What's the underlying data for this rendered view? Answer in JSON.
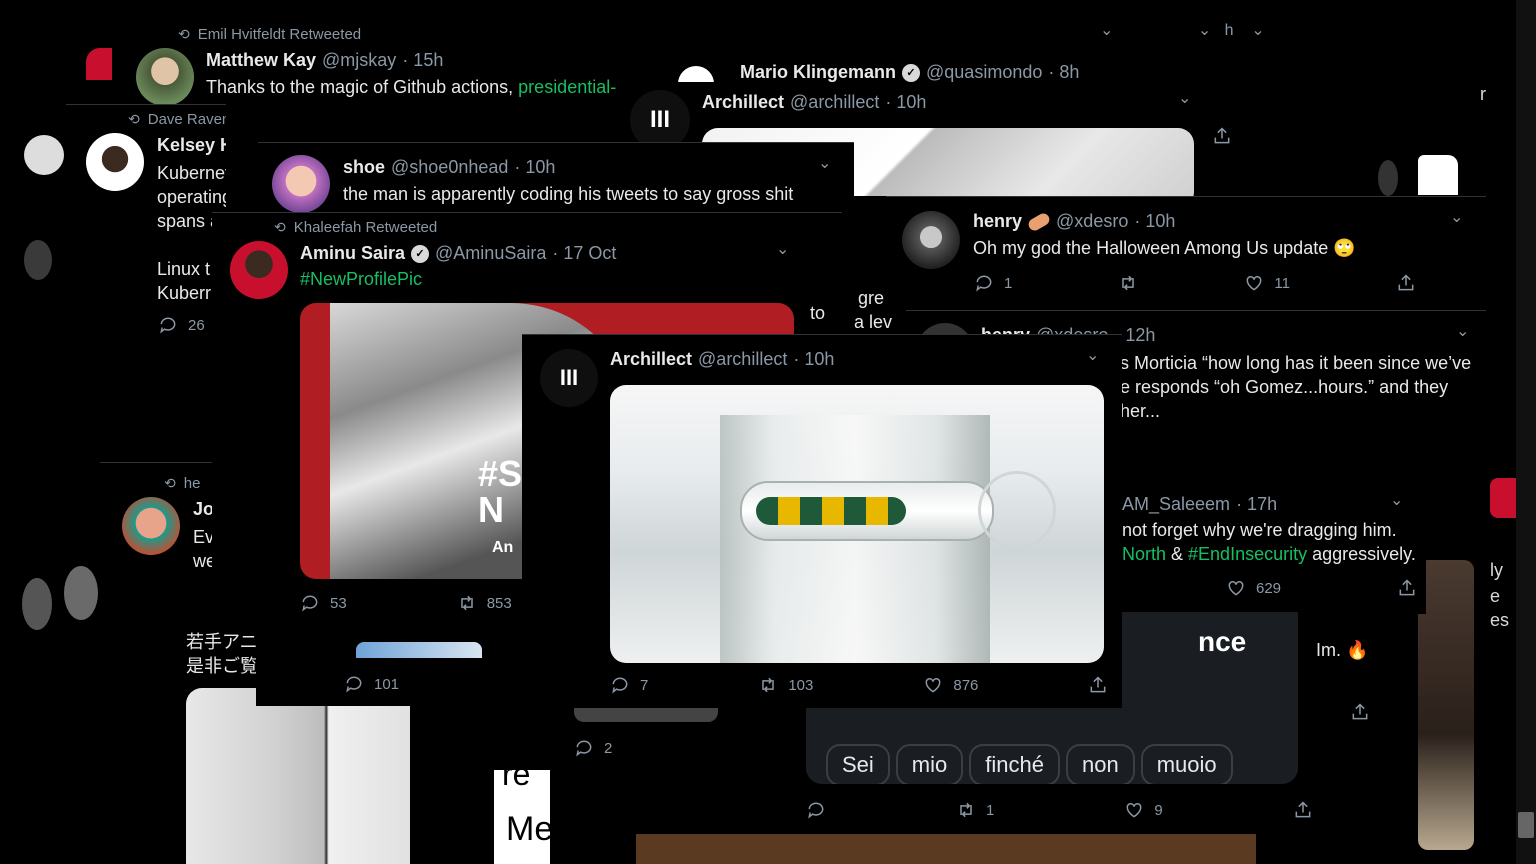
{
  "bg_color": "#000000",
  "tweets": {
    "matthew": {
      "retweet_by": "Emil Hvitfeldt Retweeted",
      "name": "Matthew Kay",
      "handle": "@mjskay",
      "time": "· 15h",
      "text_prefix": "Thanks to the magic of Github actions, ",
      "text_link": "presidential-"
    },
    "mario": {
      "name": "Mario Klingemann",
      "handle": "@quasimondo",
      "time": "· 8h"
    },
    "archillect_top": {
      "name": "Archillect",
      "handle": "@archillect",
      "time": "· 10h"
    },
    "kelsey": {
      "retweet_by": "Dave Raven Retweeted",
      "name": "Kelsey High",
      "line1": "Kubernetes i",
      "line2": "operating sy",
      "line3": "spans a",
      "line4": "Linux t",
      "line5": "Kuberr",
      "replies": "26"
    },
    "shoe": {
      "name": "shoe",
      "handle": "@shoe0nhead",
      "time": "· 10h",
      "text": "the man is apparently coding his tweets to say gross shit"
    },
    "aminu": {
      "retweet_by": "Khaleefah Retweeted",
      "name": "Aminu Saira",
      "handle": "@AminuSaira",
      "time": "· 17 Oct",
      "hashtag": "#NewProfilePic",
      "replies": "53",
      "retweets": "853",
      "side_text": "to",
      "img_text1": "#S",
      "img_text2": "N",
      "img_text3": "An"
    },
    "henry": {
      "name": "henry",
      "handle": "@xdesro",
      "time": "· 10h",
      "text": "Oh my god the Halloween Among Us update",
      "emoji": "🙄",
      "replies": "1",
      "likes": "11"
    },
    "henry2": {
      "name": "henry",
      "handle": "@xdesro",
      "time": "· 12h",
      "line1": "s Morticia “how long has it been since we’ve",
      "line2": "e responds “oh Gomez...hours.” and they",
      "line3": "her..."
    },
    "saleeem": {
      "handle": "AM_Saleeem",
      "time": "· 17h",
      "line1": "not forget why we're dragging him.",
      "line2_a": "North",
      "line2_b": " & ",
      "line2_c": "#EndInsecurity",
      "line2_d": " aggressively.",
      "likes": "629"
    },
    "archillect_main": {
      "name": "Archillect",
      "handle": "@archillect",
      "time": "· 10h",
      "replies": "7",
      "retweets": "103",
      "likes": "876"
    },
    "italian": {
      "chips": [
        "Sei",
        "mio",
        "finché",
        "non",
        "muoio"
      ],
      "title": "nce",
      "retweets": "1",
      "likes": "9",
      "side_text": "Im.",
      "side_emoji": "🔥"
    },
    "jo": {
      "retweet_by": "he",
      "name": "Jo",
      "line1": "Ev",
      "line2": "we"
    },
    "japanese": {
      "line1": "若手アニ",
      "line2": "是非ご覧",
      "replies": "101"
    },
    "misc": {
      "gre": "gre",
      "alev": "a lev",
      "count_2": "2",
      "me": "Me",
      "re": "re",
      "side_r": "r",
      "side_ly": "ly",
      "side_e": "e",
      "side_es": "es",
      "kh": "h"
    }
  }
}
